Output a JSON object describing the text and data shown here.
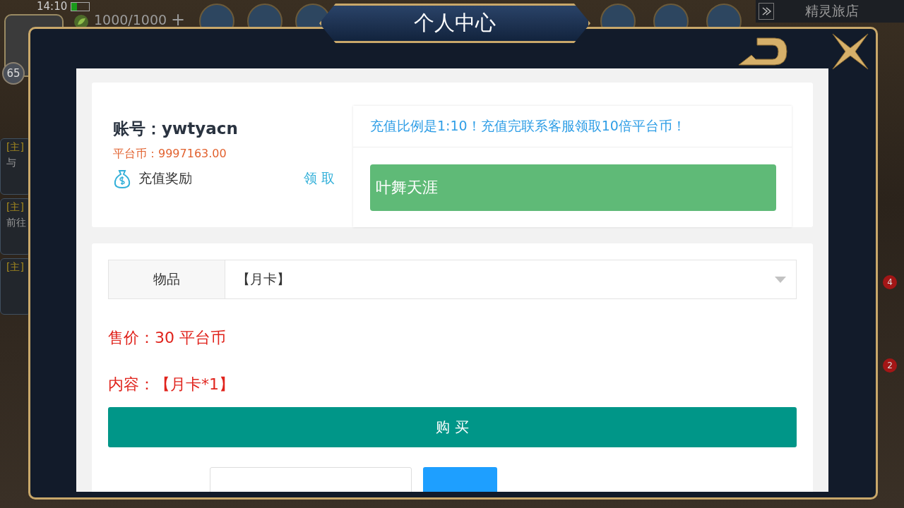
{
  "hud": {
    "time": "14:10",
    "energy": "1000/1000",
    "energy_add": "+",
    "level": "65",
    "location": "精灵旅店"
  },
  "quests": [
    {
      "tag": "[主]",
      "text": "与"
    },
    {
      "tag": "[主]",
      "text": "前往"
    },
    {
      "tag": "[主]"
    }
  ],
  "badges": [
    "4",
    "2"
  ],
  "dialog": {
    "title": "个人中心",
    "account": {
      "label": "账号：ywtyacn",
      "coins": "平台币：9997163.00",
      "reward_label": "充值奖励",
      "reward_action": "领 取"
    },
    "notice": "充值比例是1:10！充值完联系客服领取10倍平台币！",
    "server": "叶舞天涯",
    "item": {
      "label": "物品",
      "value": "【月卡】"
    },
    "price": "售价：30 平台币",
    "content": "内容：【月卡*1】",
    "buy": "购 买"
  }
}
